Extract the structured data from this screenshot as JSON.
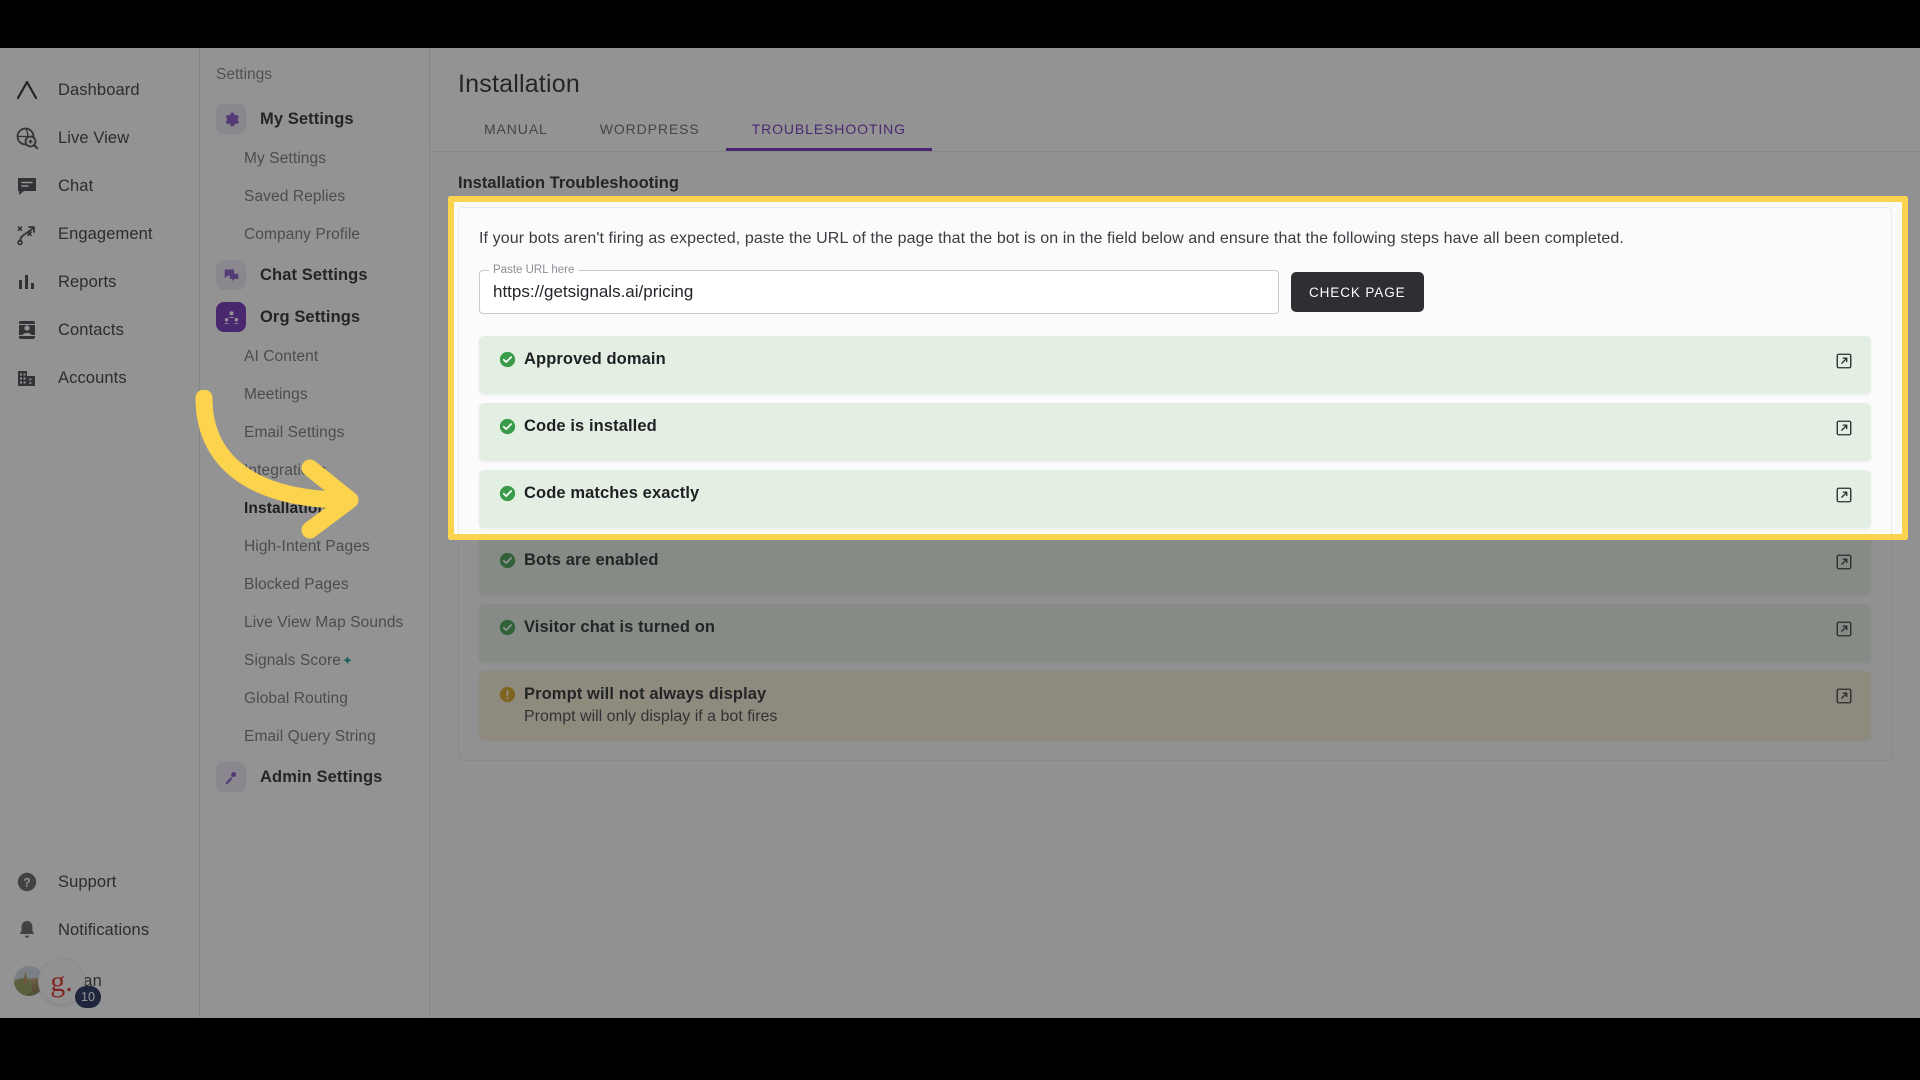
{
  "sidebar": {
    "items": [
      {
        "label": "Dashboard",
        "icon": "logo-caret-icon"
      },
      {
        "label": "Live View",
        "icon": "globe-search-icon"
      },
      {
        "label": "Chat",
        "icon": "chat-bubble-icon"
      },
      {
        "label": "Engagement",
        "icon": "engagement-playbook-icon"
      },
      {
        "label": "Reports",
        "icon": "bar-chart-icon"
      },
      {
        "label": "Contacts",
        "icon": "contact-card-icon"
      },
      {
        "label": "Accounts",
        "icon": "building-icon"
      }
    ],
    "bottom": [
      {
        "label": "Support",
        "icon": "help-circle-icon"
      },
      {
        "label": "Notifications",
        "icon": "bell-icon"
      }
    ],
    "user": {
      "name": "Ngan",
      "badge_letter": "g.",
      "notification_count": "10"
    },
    "collapse_icon": "chevron-left-icon"
  },
  "settings_nav": {
    "title": "Settings",
    "groups": [
      {
        "label": "My Settings",
        "icon": "gear-icon",
        "icon_style": "light",
        "items": [
          {
            "label": "My Settings",
            "active": false
          },
          {
            "label": "Saved Replies",
            "active": false
          },
          {
            "label": "Company Profile",
            "active": false
          }
        ]
      },
      {
        "label": "Chat Settings",
        "icon": "chat-settings-icon",
        "icon_style": "light",
        "items": []
      },
      {
        "label": "Org Settings",
        "icon": "org-users-icon",
        "icon_style": "solid",
        "items": [
          {
            "label": "AI Content",
            "active": false
          },
          {
            "label": "Meetings",
            "active": false
          },
          {
            "label": "Email Settings",
            "active": false
          },
          {
            "label": "Integrations",
            "active": false
          },
          {
            "label": "Installation",
            "active": true
          },
          {
            "label": "High-Intent Pages",
            "active": false
          },
          {
            "label": "Blocked Pages",
            "active": false
          },
          {
            "label": "Live View Map Sounds",
            "active": false
          },
          {
            "label": "Signals Score",
            "active": false,
            "sup": "✦"
          },
          {
            "label": "Global Routing",
            "active": false
          },
          {
            "label": "Email Query String",
            "active": false
          }
        ]
      },
      {
        "label": "Admin Settings",
        "icon": "admin-key-icon",
        "icon_style": "light",
        "items": []
      }
    ]
  },
  "main": {
    "page_title": "Installation",
    "tabs": [
      {
        "label": "MANUAL",
        "active": false
      },
      {
        "label": "WORDPRESS",
        "active": false
      },
      {
        "label": "TROUBLESHOOTING",
        "active": true
      }
    ],
    "section_title": "Installation Troubleshooting",
    "description": "If your bots aren't firing as expected, paste the URL of the page that the bot is on in the field below and ensure that the following steps have all been completed.",
    "url_field": {
      "label": "Paste URL here",
      "value": "https://getsignals.ai/pricing",
      "placeholder": "Paste URL here"
    },
    "check_button": "CHECK PAGE",
    "statuses": [
      {
        "text": "Approved domain",
        "state": "ok",
        "sub": "",
        "action_icon": "external-link-icon"
      },
      {
        "text": "Code is installed",
        "state": "ok",
        "sub": "",
        "action_icon": "external-link-icon"
      },
      {
        "text": "Code matches exactly",
        "state": "ok",
        "sub": "",
        "action_icon": "external-link-icon"
      },
      {
        "text": "Bots are enabled",
        "state": "ok",
        "sub": "",
        "action_icon": "external-link-icon"
      },
      {
        "text": "Visitor chat is turned on",
        "state": "ok",
        "sub": "",
        "action_icon": "external-link-icon"
      },
      {
        "text": "Prompt will not always display",
        "state": "warn",
        "sub": "Prompt will only display if a bot fires",
        "action_icon": "external-link-icon"
      }
    ]
  },
  "annotation": {
    "highlight_color": "#fcd34d",
    "arrow_color": "#fcd34d",
    "arrow_target": "Installation"
  },
  "colors": {
    "accent": "#6d28b8",
    "ok": "#3a9b48",
    "warn": "#d9a21b",
    "dark_button": "#2e2f33"
  }
}
